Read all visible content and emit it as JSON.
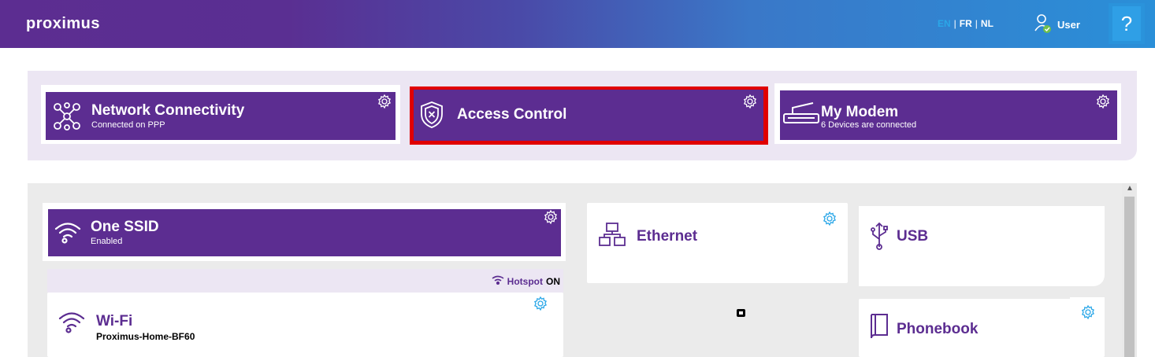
{
  "header": {
    "logo": "proximus",
    "languages": [
      "EN",
      "FR",
      "NL"
    ],
    "active_language": "EN",
    "user_label": "User",
    "help_symbol": "?"
  },
  "top_tiles": [
    {
      "title": "Network Connectivity",
      "subtitle": "Connected on PPP",
      "icon": "network-icon"
    },
    {
      "title": "Access Control",
      "subtitle": "",
      "icon": "shield-icon"
    },
    {
      "title": "My Modem",
      "subtitle": "6 Devices are connected",
      "icon": "modem-icon"
    }
  ],
  "one_ssid": {
    "title": "One SSID",
    "subtitle": "Enabled"
  },
  "hotspot": {
    "label": "Hotspot",
    "state": "ON"
  },
  "wifi": {
    "title": "Wi-Fi",
    "ssid": "Proximus-Home-BF60"
  },
  "ethernet": {
    "title": "Ethernet"
  },
  "usb": {
    "title": "USB"
  },
  "phonebook": {
    "title": "Phonebook"
  },
  "colors": {
    "brand": "#5c2d91",
    "accent": "#2aa7e8",
    "highlight": "#e00000"
  }
}
